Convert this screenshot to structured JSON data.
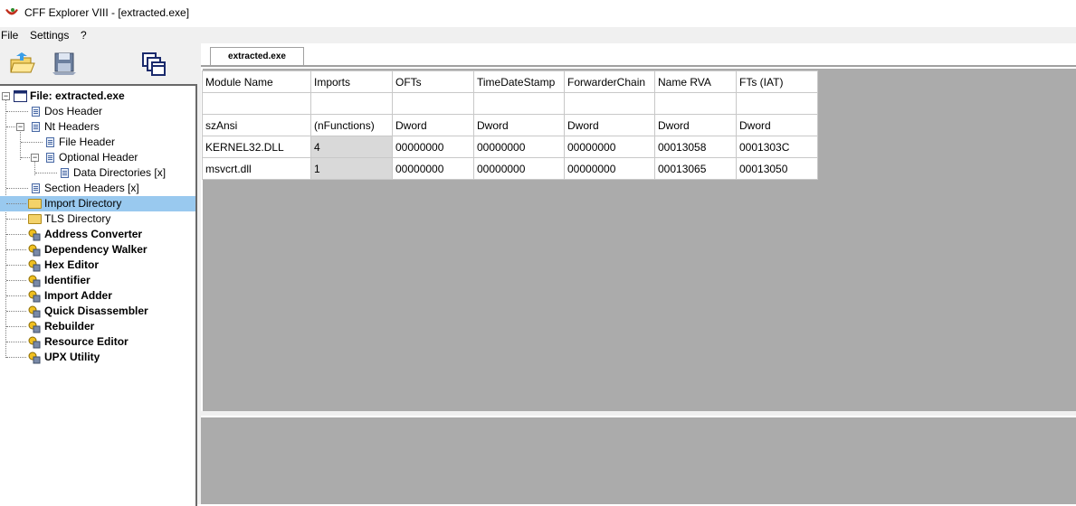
{
  "window": {
    "title": "CFF Explorer VIII - [extracted.exe]"
  },
  "menu": [
    {
      "label": "File"
    },
    {
      "label": "Settings"
    },
    {
      "label": "?"
    }
  ],
  "toolbar": {
    "icons": [
      "open-file-icon",
      "save-disk-icon",
      "windows-icon"
    ]
  },
  "tree": {
    "root": {
      "label": "File: extracted.exe",
      "icon": "window-icon"
    },
    "items": [
      {
        "label": "Dos Header",
        "icon": "doc-icon"
      },
      {
        "label": "Nt Headers",
        "icon": "doc-icon"
      },
      {
        "label": "File Header",
        "icon": "doc-icon"
      },
      {
        "label": "Optional Header",
        "icon": "doc-icon"
      },
      {
        "label": "Data Directories [x]",
        "icon": "doc-icon"
      },
      {
        "label": "Section Headers [x]",
        "icon": "doc-icon"
      },
      {
        "label": "Import Directory",
        "icon": "folder-icon",
        "selected": true
      },
      {
        "label": "TLS Directory",
        "icon": "folder-icon"
      },
      {
        "label": "Address Converter",
        "icon": "tool-icon"
      },
      {
        "label": "Dependency Walker",
        "icon": "tool-icon"
      },
      {
        "label": "Hex Editor",
        "icon": "tool-icon"
      },
      {
        "label": "Identifier",
        "icon": "tool-icon"
      },
      {
        "label": "Import Adder",
        "icon": "tool-icon"
      },
      {
        "label": "Quick Disassembler",
        "icon": "tool-icon"
      },
      {
        "label": "Rebuilder",
        "icon": "tool-icon"
      },
      {
        "label": "Resource Editor",
        "icon": "tool-icon"
      },
      {
        "label": "UPX Utility",
        "icon": "tool-icon"
      }
    ]
  },
  "tab": {
    "label": "extracted.exe"
  },
  "grid": {
    "headers": [
      "Module Name",
      "Imports",
      "OFTs",
      "TimeDateStamp",
      "ForwarderChain",
      "Name RVA",
      "FTs (IAT)"
    ],
    "types": [
      "szAnsi",
      "(nFunctions)",
      "Dword",
      "Dword",
      "Dword",
      "Dword",
      "Dword"
    ],
    "rows": [
      [
        "KERNEL32.DLL",
        "4",
        "00000000",
        "00000000",
        "00000000",
        "00013058",
        "0001303C"
      ],
      [
        "msvcrt.dll",
        "1",
        "00000000",
        "00000000",
        "00000000",
        "00013065",
        "00013050"
      ]
    ]
  },
  "colors": {
    "selection": "#99c9ef",
    "panel": "#ababab",
    "chrome": "#f0f0f0"
  }
}
